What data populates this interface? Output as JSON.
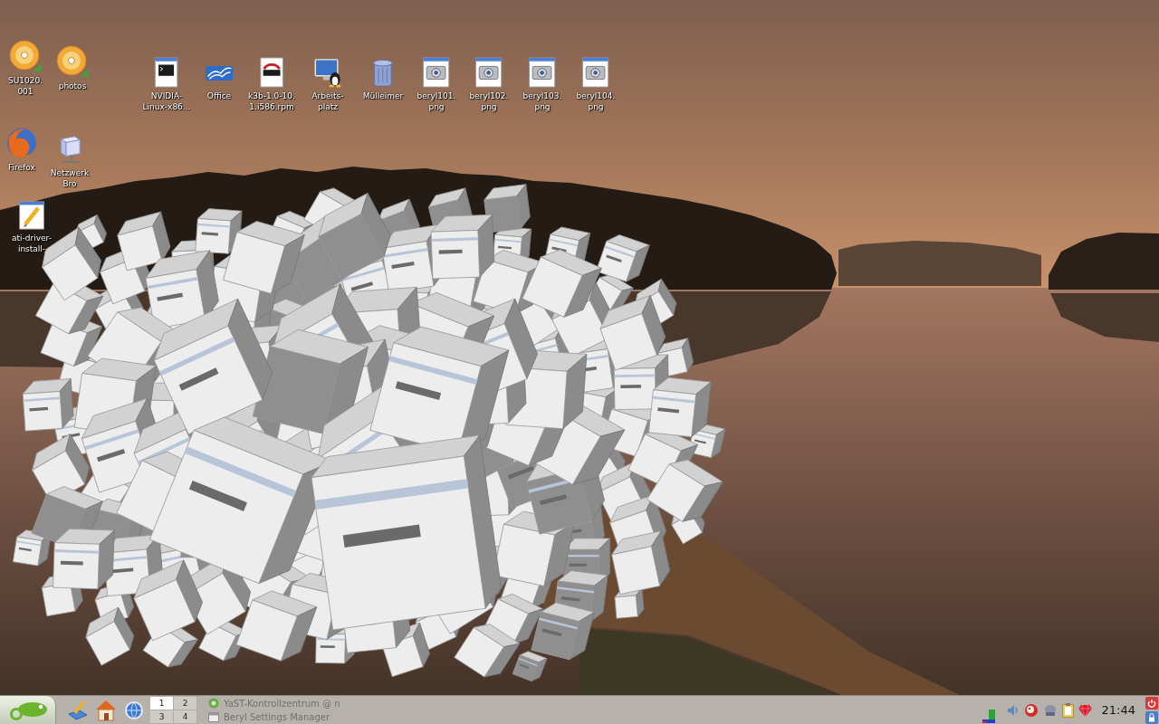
{
  "desktop": {
    "icons": [
      {
        "kind": "disc",
        "label": "SU1020.\n001"
      },
      {
        "kind": "disc",
        "label": "photos"
      },
      {
        "kind": "terminal",
        "label": "NVIDIA-\nLinux-x86..."
      },
      {
        "kind": "office",
        "label": "Office"
      },
      {
        "kind": "package",
        "label": "k3b-1.0-10.\n1.i586.rpm"
      },
      {
        "kind": "computer",
        "label": "Arbeits-\nplatz"
      },
      {
        "kind": "trash",
        "label": "Mülleimer"
      },
      {
        "kind": "image",
        "label": "beryl101.\npng"
      },
      {
        "kind": "image",
        "label": "beryl102.\npng"
      },
      {
        "kind": "image",
        "label": "beryl103.\npng"
      },
      {
        "kind": "image",
        "label": "beryl104.\npng"
      },
      {
        "kind": "browser",
        "label": "Firefox"
      },
      {
        "kind": "network",
        "label": "Netzwerk\nBro"
      },
      {
        "kind": "script",
        "label": "ati-driver-\ninstall-"
      }
    ]
  },
  "taskbar": {
    "pager": [
      {
        "label": "1",
        "selected": true
      },
      {
        "label": "2",
        "selected": false
      },
      {
        "label": "3",
        "selected": false
      },
      {
        "label": "4",
        "selected": false
      }
    ],
    "tasks": [
      {
        "kind": "circle",
        "label": "YaST-Kontrollzentrum @ n"
      },
      {
        "kind": "window",
        "label": "Beryl Settings Manager"
      }
    ],
    "clock": "21:44"
  }
}
